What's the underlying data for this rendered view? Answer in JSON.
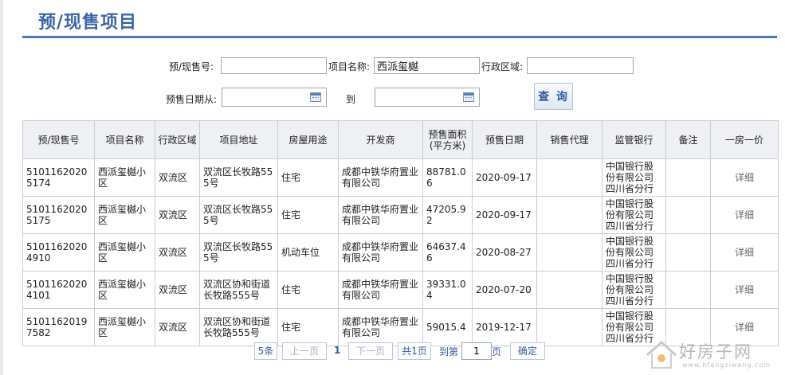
{
  "page": {
    "title": "预/现售项目"
  },
  "search": {
    "presale_no_label": "预/现售号:",
    "presale_no_value": "",
    "project_name_label": "项目名称:",
    "project_name_value": "西派玺樾",
    "district_label": "行政区域:",
    "district_value": "",
    "date_from_label": "预售日期从:",
    "date_from_value": "",
    "date_to_label": "到",
    "date_to_value": "",
    "query_label": "查 询"
  },
  "table": {
    "headers": {
      "presale_no": "预/现售号",
      "project_name": "项目名称",
      "district": "行政区域",
      "address": "项目地址",
      "usage": "房屋用途",
      "developer": "开发商",
      "area": "预售面积\n(平方米)",
      "date": "预售日期",
      "agent": "销售代理",
      "bank": "监管银行",
      "remark": "备注",
      "price": "一房一价"
    },
    "rows": [
      {
        "presale_no": "51011620205174",
        "project_name": "西派玺樾小区",
        "district": "双流区",
        "address": "双流区长牧路555号",
        "usage": "住宅",
        "developer": "成都中铁华府置业有限公司",
        "area": "88781.06",
        "date": "2020-09-17",
        "agent": "",
        "bank": "中国银行股份有限公司四川省分行",
        "remark": "",
        "detail": "详细"
      },
      {
        "presale_no": "51011620205175",
        "project_name": "西派玺樾小区",
        "district": "双流区",
        "address": "双流区长牧路555号",
        "usage": "住宅",
        "developer": "成都中铁华府置业有限公司",
        "area": "47205.92",
        "date": "2020-09-17",
        "agent": "",
        "bank": "中国银行股份有限公司四川省分行",
        "remark": "",
        "detail": "详细"
      },
      {
        "presale_no": "51011620204910",
        "project_name": "西派玺樾小区",
        "district": "双流区",
        "address": "双流区长牧路555号",
        "usage": "机动车位",
        "developer": "成都中铁华府置业有限公司",
        "area": "64637.46",
        "date": "2020-08-27",
        "agent": "",
        "bank": "中国银行股份有限公司四川省分行",
        "remark": "",
        "detail": "详细"
      },
      {
        "presale_no": "51011620204101",
        "project_name": "西派玺樾小区",
        "district": "双流区",
        "address": "双流区协和街道长牧路555号",
        "usage": "住宅",
        "developer": "成都中铁华府置业有限公司",
        "area": "39331.04",
        "date": "2020-07-20",
        "agent": "",
        "bank": "中国银行股份有限公司四川省分行",
        "remark": "",
        "detail": "详细"
      },
      {
        "presale_no": "51011620197582",
        "project_name": "西派玺樾小区",
        "district": "双流区",
        "address": "双流区协和街道长牧路555号",
        "usage": "住宅",
        "developer": "成都中铁华府置业有限公司",
        "area": "59015.4",
        "date": "2019-12-17",
        "agent": "",
        "bank": "中国银行股份有限公司四川省分行",
        "remark": "",
        "detail": "详细"
      }
    ]
  },
  "pager": {
    "count_label": "5条",
    "prev_label": "上一页",
    "current_page": "1",
    "next_label": "下一页",
    "total_label": "共1页",
    "goto_label": "到第",
    "goto_value": "1",
    "page_suffix": "页",
    "confirm_label": "确定"
  },
  "watermark": {
    "text": "好房子网",
    "url": "www.hfangziwang.com"
  },
  "colors": {
    "accent": "#3b66a4",
    "header_rule": "#4b78b8",
    "table_header_bg": "#eef0f3",
    "border": "#c9ced6"
  }
}
